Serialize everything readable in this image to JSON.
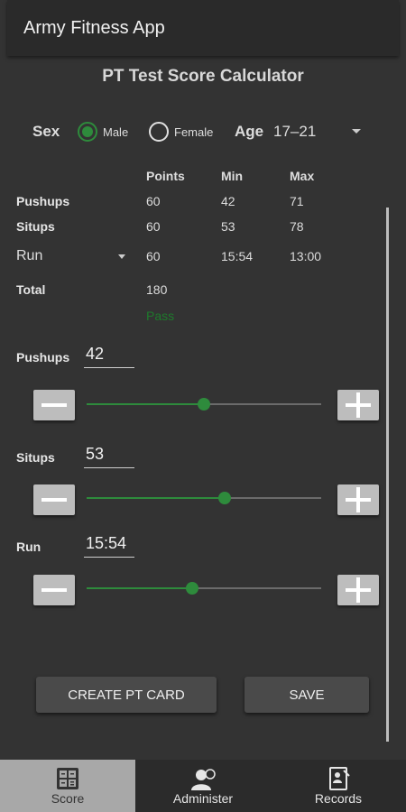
{
  "app": {
    "title": "Army Fitness App"
  },
  "page": {
    "title": "PT Test Score Calculator"
  },
  "form": {
    "sex_label": "Sex",
    "male_label": "Male",
    "female_label": "Female",
    "selected_sex": "Male",
    "age_label": "Age",
    "age_value": "17–21"
  },
  "table": {
    "headers": [
      "Points",
      "Min",
      "Max"
    ],
    "rows": [
      {
        "label": "Pushups",
        "points": "60",
        "min": "42",
        "max": "71"
      },
      {
        "label": "Situps",
        "points": "60",
        "min": "53",
        "max": "78"
      },
      {
        "label": "Run",
        "points": "60",
        "min": "15:54",
        "max": "13:00"
      }
    ],
    "total_label": "Total",
    "total_value": "180",
    "result": "Pass"
  },
  "controls": [
    {
      "label": "Pushups",
      "value": "42",
      "slider_fraction": 0.5
    },
    {
      "label": "Situps",
      "value": "53",
      "slider_fraction": 0.59
    },
    {
      "label": "Run",
      "value": "15:54",
      "slider_fraction": 0.45
    }
  ],
  "buttons": {
    "create": "CREATE PT CARD",
    "save": "SAVE"
  },
  "nav": [
    {
      "label": "Score",
      "icon": "calculator-icon",
      "active": true
    },
    {
      "label": "Administer",
      "icon": "person-icon",
      "active": false
    },
    {
      "label": "Records",
      "icon": "document-icon",
      "active": false
    }
  ],
  "colors": {
    "accent": "#2e8b3c",
    "background": "#333333",
    "appbar": "#2a2a2a"
  }
}
